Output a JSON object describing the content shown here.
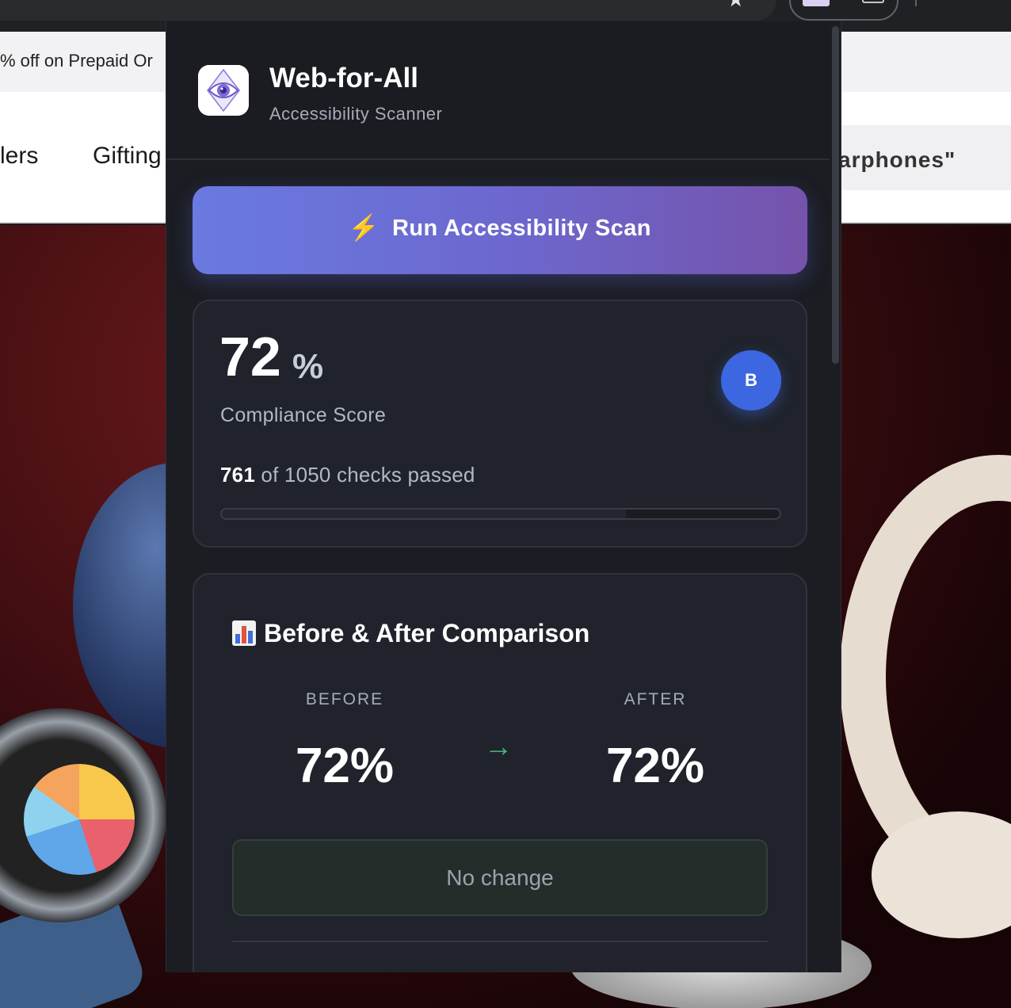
{
  "colors": {
    "popup_bg": "#1b1d23",
    "card_bg": "#20232b",
    "accent_gradient_start": "#6a7ae0",
    "accent_gradient_end": "#7553ab",
    "grade_badge": "#3c67e0",
    "arrow_green": "#48b774"
  },
  "background_page": {
    "offer_text": "% off on Prepaid Or",
    "nav_items": [
      "lers",
      "Gifting"
    ],
    "search_text": "arphones\""
  },
  "popup": {
    "header": {
      "title": "Web-for-All",
      "subtitle": "Accessibility Scanner",
      "logo_icon": "eye-icon"
    },
    "scan_button": {
      "icon": "lightning-icon",
      "icon_glyph": "⚡",
      "label": "Run Accessibility Scan"
    },
    "score": {
      "value": "72",
      "unit": "%",
      "label": "Compliance Score",
      "grade": "B",
      "checks_passed": "761",
      "checks_text": "of 1050 checks passed",
      "progress_fraction": 0.725
    },
    "comparison": {
      "icon": "bar-chart-icon",
      "title": "Before & After Comparison",
      "before_label": "BEFORE",
      "before_value": "72%",
      "arrow_glyph": "→",
      "after_label": "AFTER",
      "after_value": "72%",
      "change_text": "No change"
    }
  }
}
